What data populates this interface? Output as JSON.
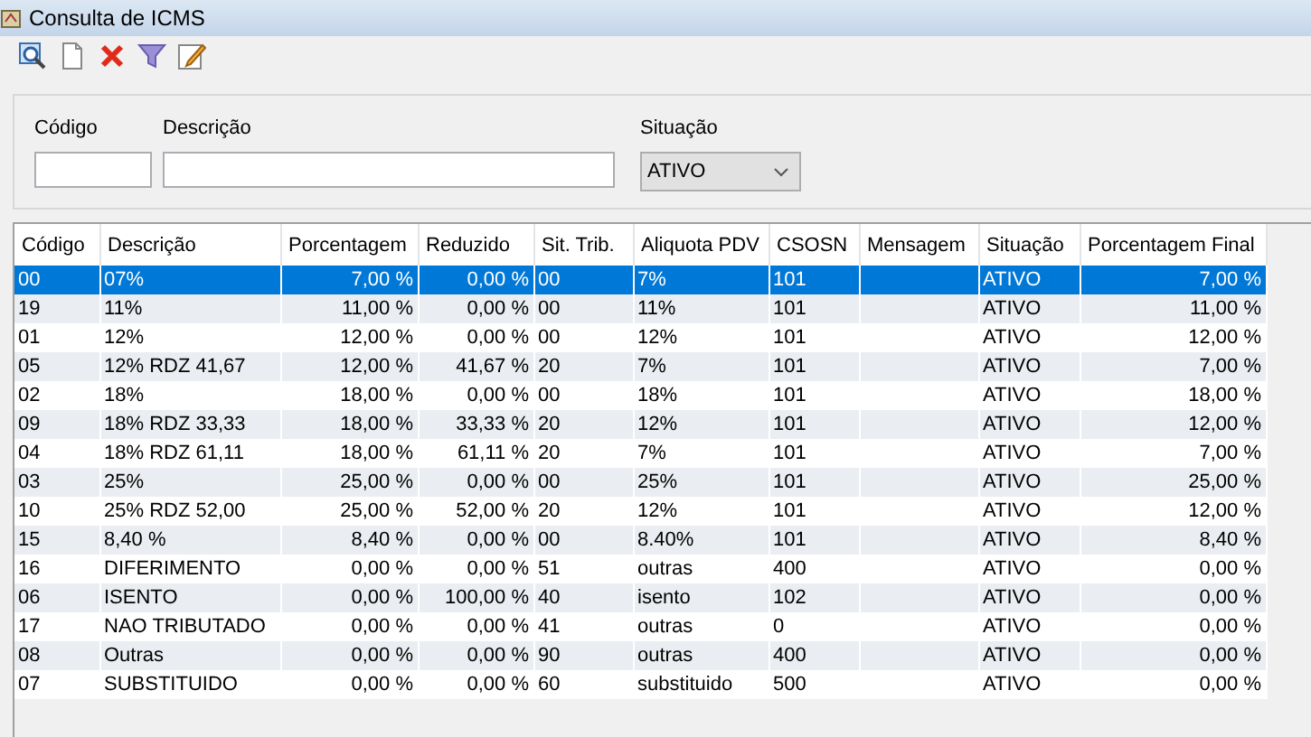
{
  "window": {
    "title": "Consulta de ICMS"
  },
  "filters": {
    "codigo": {
      "label": "Código"
    },
    "descricao": {
      "label": "Descrição"
    },
    "situacao": {
      "label": "Situação",
      "value": "ATIVO"
    }
  },
  "table": {
    "columns": [
      "Código",
      "Descrição",
      "Porcentagem",
      "Reduzido",
      "Sit. Trib.",
      "Aliquota PDV",
      "CSOSN",
      "Mensagem",
      "Situação",
      "Porcentagem Final"
    ],
    "rows": [
      {
        "selected": true,
        "cells": [
          "00",
          "07%",
          "7,00 %",
          "0,00 %",
          "00",
          "7%",
          "101",
          "",
          "ATIVO",
          "7,00 %"
        ]
      },
      {
        "selected": false,
        "cells": [
          "19",
          "11%",
          "11,00 %",
          "0,00 %",
          "00",
          "11%",
          "101",
          "",
          "ATIVO",
          "11,00 %"
        ]
      },
      {
        "selected": false,
        "cells": [
          "01",
          "12%",
          "12,00 %",
          "0,00 %",
          "00",
          "12%",
          "101",
          "",
          "ATIVO",
          "12,00 %"
        ]
      },
      {
        "selected": false,
        "cells": [
          "05",
          "12%  RDZ 41,67",
          "12,00 %",
          "41,67 %",
          "20",
          "7%",
          "101",
          "",
          "ATIVO",
          "7,00 %"
        ]
      },
      {
        "selected": false,
        "cells": [
          "02",
          "18%",
          "18,00 %",
          "0,00 %",
          "00",
          "18%",
          "101",
          "",
          "ATIVO",
          "18,00 %"
        ]
      },
      {
        "selected": false,
        "cells": [
          "09",
          "18%  RDZ 33,33",
          "18,00 %",
          "33,33 %",
          "20",
          "12%",
          "101",
          "",
          "ATIVO",
          "12,00 %"
        ]
      },
      {
        "selected": false,
        "cells": [
          "04",
          "18%  RDZ 61,11",
          "18,00 %",
          "61,11 %",
          "20",
          "7%",
          "101",
          "",
          "ATIVO",
          "7,00 %"
        ]
      },
      {
        "selected": false,
        "cells": [
          "03",
          "25%",
          "25,00 %",
          "0,00 %",
          "00",
          "25%",
          "101",
          "",
          "ATIVO",
          "25,00 %"
        ]
      },
      {
        "selected": false,
        "cells": [
          "10",
          "25%  RDZ 52,00",
          "25,00 %",
          "52,00 %",
          "20",
          "12%",
          "101",
          "",
          "ATIVO",
          "12,00 %"
        ]
      },
      {
        "selected": false,
        "cells": [
          "15",
          "8,40 %",
          "8,40 %",
          "0,00 %",
          "00",
          "8.40%",
          "101",
          "",
          "ATIVO",
          "8,40 %"
        ]
      },
      {
        "selected": false,
        "cells": [
          "16",
          "DIFERIMENTO",
          "0,00 %",
          "0,00 %",
          "51",
          "outras",
          "400",
          "",
          "ATIVO",
          "0,00 %"
        ]
      },
      {
        "selected": false,
        "cells": [
          "06",
          "ISENTO",
          "0,00 %",
          "100,00 %",
          "40",
          "isento",
          "102",
          "",
          "ATIVO",
          "0,00 %"
        ]
      },
      {
        "selected": false,
        "cells": [
          "17",
          "NAO TRIBUTADO",
          "0,00 %",
          "0,00 %",
          "41",
          "outras",
          "0",
          "",
          "ATIVO",
          "0,00 %"
        ]
      },
      {
        "selected": false,
        "cells": [
          "08",
          "Outras",
          "0,00 %",
          "0,00 %",
          "90",
          "outras",
          "400",
          "",
          "ATIVO",
          "0,00 %"
        ]
      },
      {
        "selected": false,
        "cells": [
          "07",
          "SUBSTITUIDO",
          "0,00 %",
          "0,00 %",
          "60",
          "substituido",
          "500",
          "",
          "ATIVO",
          "0,00 %"
        ]
      }
    ]
  }
}
